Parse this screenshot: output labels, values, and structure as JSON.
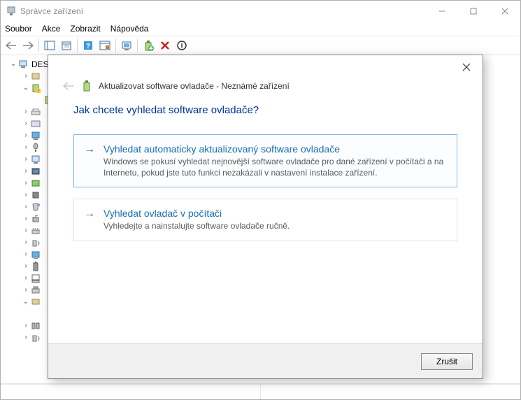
{
  "window": {
    "title": "Správce zařízení"
  },
  "menu": {
    "file": "Soubor",
    "action": "Akce",
    "view": "Zobrazit",
    "help": "Nápověda"
  },
  "tree": {
    "root": "DES"
  },
  "dialog": {
    "title": "Aktualizovat software ovladače - Neznámé zařízení",
    "question": "Jak chcete vyhledat software ovladače?",
    "option1": {
      "title": "Vyhledat automaticky aktualizovaný software ovladače",
      "desc": "Windows se pokusí vyhledat nejnovější software ovladače pro dané zařízení v počítači a na Internetu, pokud jste tuto funkci nezakázali v nastavení instalace zařízení."
    },
    "option2": {
      "title": "Vyhledat ovladač v počítači",
      "desc": "Vyhledejte a nainstalujte software ovladače ručně."
    },
    "cancel": "Zrušit"
  }
}
